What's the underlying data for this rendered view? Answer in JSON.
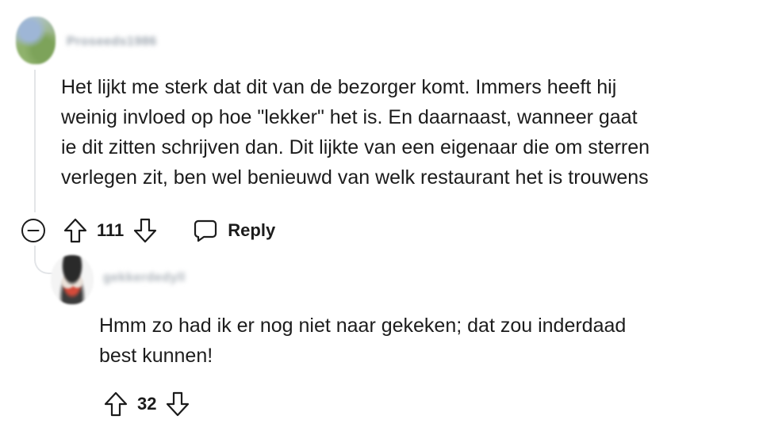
{
  "comments": [
    {
      "username": "Proseeds1986",
      "body_lines": [
        "Het lijkt me sterk dat dit van de bezorger komt. Immers heeft hij",
        "weinig invloed op hoe \"lekker\" het is. En daarnaast, wanneer gaat",
        "ie dit zitten schrijven dan. Dit lijkte van een eigenaar die om sterren",
        "verlegen zit, ben wel benieuwd van welk restaurant het is trouwens"
      ],
      "votes": "111",
      "reply_label": "Reply",
      "icons": {
        "collapse": "collapse-minus-icon",
        "upvote": "upvote-arrow-icon",
        "downvote": "downvote-arrow-icon",
        "reply": "speech-bubble-icon"
      }
    },
    {
      "username": "gekkerdedyll",
      "body_lines": [
        "Hmm zo had ik er nog niet naar gekeken; dat zou inderdaad",
        "best kunnen!"
      ],
      "votes": "32",
      "icons": {
        "upvote": "upvote-arrow-icon",
        "downvote": "downvote-arrow-icon"
      }
    }
  ],
  "colors": {
    "text": "#1c1c1c",
    "thread_line": "#e3e5e8",
    "background": "#ffffff"
  }
}
